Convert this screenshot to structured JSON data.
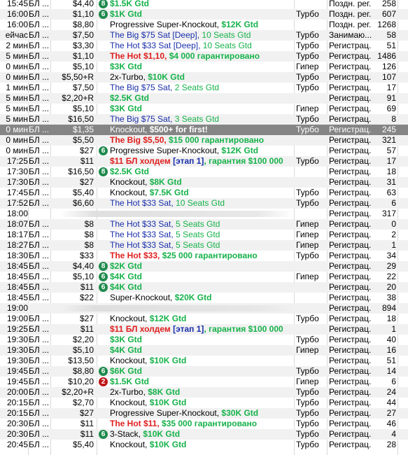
{
  "lobby": {
    "rows": [
      {
        "time": "15:45",
        "game": "БЛ ...",
        "buyin": "$4,40",
        "badge": "8",
        "badge_color": "green",
        "name": [
          {
            "t": "$1.5K Gtd",
            "s": "grn"
          }
        ],
        "speed": "",
        "status": "Поздн. рег.",
        "players": "258"
      },
      {
        "time": "16:00",
        "game": "БЛ ...",
        "buyin": "$1,10",
        "badge": "6",
        "badge_color": "green",
        "name": [
          {
            "t": "$1K Gtd",
            "s": "grn"
          }
        ],
        "speed": "Турбо",
        "status": "Поздн. рег.",
        "players": "607"
      },
      {
        "time": "16:00",
        "game": "БЛ ...",
        "buyin": "$8,80",
        "badge": "",
        "name": [
          {
            "t": "Progressive Super-Knockout, ",
            "s": ""
          },
          {
            "t": "$12K Gtd",
            "s": "grn"
          }
        ],
        "speed": "",
        "status": "Поздн. рег.",
        "players": "1268"
      },
      {
        "time": "ейчас",
        "game": "БЛ ...",
        "buyin": "$7,50",
        "badge": "",
        "name": [
          {
            "t": "The Big $75 Sat [Deep], ",
            "s": "nav"
          },
          {
            "t": "10 Seats Gtd",
            "s": "grn-n"
          }
        ],
        "speed": "Турбо",
        "status": "Занимаю...",
        "players": "58"
      },
      {
        "time": "2 мин",
        "game": "БЛ ...",
        "buyin": "$3,30",
        "badge": "",
        "name": [
          {
            "t": "The Hot $33 Sat [Deep], ",
            "s": "nav"
          },
          {
            "t": "10 Seats Gtd",
            "s": "grn-n"
          }
        ],
        "speed": "Турбо",
        "status": "Регистрац.",
        "players": "51"
      },
      {
        "time": "5 мин",
        "game": "БЛ ...",
        "buyin": "$1,10",
        "badge": "",
        "name": [
          {
            "t": "The Hot ",
            "s": "red"
          },
          {
            "t": "$1,10",
            "s": "red"
          },
          {
            "t": ", ",
            "s": "red"
          },
          {
            "t": "$4 000 гарантировано",
            "s": "grn"
          }
        ],
        "speed": "Турбо",
        "status": "Регистрац.",
        "players": "1486"
      },
      {
        "time": "0 мин",
        "game": "БЛ ...",
        "buyin": "$5,10",
        "badge": "",
        "name": [
          {
            "t": "$3K Gtd",
            "s": "grn"
          }
        ],
        "speed": "Гипер",
        "status": "Регистрац.",
        "players": "126"
      },
      {
        "time": "0 мин",
        "game": "БЛ ...",
        "buyin": "$5,50+R",
        "badge": "",
        "name": [
          {
            "t": "2x-Turbo, ",
            "s": ""
          },
          {
            "t": "$10K Gtd",
            "s": "grn"
          }
        ],
        "speed": "Турбо",
        "status": "Регистрац.",
        "players": "107"
      },
      {
        "time": "1 мин",
        "game": "БЛ ...",
        "buyin": "$7,50",
        "badge": "",
        "name": [
          {
            "t": "The Big $75 Sat, ",
            "s": "nav"
          },
          {
            "t": "2 Seats Gtd",
            "s": "grn-n"
          }
        ],
        "speed": "Турбо",
        "status": "Регистрац.",
        "players": "17"
      },
      {
        "time": "5 мин",
        "game": "БЛ ...",
        "buyin": "$2,20+R",
        "badge": "",
        "name": [
          {
            "t": "$2.5K Gtd",
            "s": "grn"
          }
        ],
        "speed": "",
        "status": "Регистрац.",
        "players": "91"
      },
      {
        "time": "5 мин",
        "game": "БЛ ...",
        "buyin": "$5,10",
        "badge": "",
        "name": [
          {
            "t": "$3K Gtd",
            "s": "grn"
          }
        ],
        "speed": "Гипер",
        "status": "Регистрац.",
        "players": "69"
      },
      {
        "time": "5 мин",
        "game": "БЛ ...",
        "buyin": "$16,50",
        "badge": "",
        "name": [
          {
            "t": "The Big $75 Sat, ",
            "s": "nav"
          },
          {
            "t": "3 Seats Gtd",
            "s": "grn-n"
          }
        ],
        "speed": "Турбо",
        "status": "Регистрац.",
        "players": "8"
      },
      {
        "time": "0 мин",
        "game": "БЛ ...",
        "buyin": "$1,35",
        "badge": "",
        "name": [
          {
            "t": "Knockout, ",
            "s": ""
          },
          {
            "t": "$500+ for first!",
            "s": "grn"
          }
        ],
        "speed": "Турбо",
        "status": "Регистрац.",
        "players": "245",
        "selected": true
      },
      {
        "time": "0 мин",
        "game": "БЛ ...",
        "buyin": "$5,50",
        "badge": "",
        "name": [
          {
            "t": "The Big ",
            "s": "red"
          },
          {
            "t": "$5,50",
            "s": "red"
          },
          {
            "t": ", ",
            "s": "red"
          },
          {
            "t": "$15 000 гарантировано",
            "s": "grn"
          }
        ],
        "speed": "",
        "status": "Регистрац.",
        "players": "321"
      },
      {
        "time": "0 мин",
        "game": "БЛ ...",
        "buyin": "$27",
        "badge": "6",
        "badge_color": "green",
        "name": [
          {
            "t": "Progressive Super-Knockout, ",
            "s": ""
          },
          {
            "t": "$12K Gtd",
            "s": "grn"
          }
        ],
        "speed": "",
        "status": "Регистрац.",
        "players": "57"
      },
      {
        "time": "17:25",
        "game": "БЛ ...",
        "buyin": "$11",
        "badge": "",
        "name": [
          {
            "t": "$11 БЛ холдем ",
            "s": "red"
          },
          {
            "t": "[этап 1]",
            "s": "blu"
          },
          {
            "t": ", гарантия $100 000",
            "s": "grn"
          }
        ],
        "speed": "Турбо",
        "status": "Регистрац.",
        "players": "17"
      },
      {
        "time": "17:30",
        "game": "БЛ ...",
        "buyin": "$16,50",
        "badge": "8",
        "badge_color": "green",
        "name": [
          {
            "t": "$2.5K Gtd",
            "s": "grn"
          }
        ],
        "speed": "",
        "status": "Регистрац.",
        "players": "18"
      },
      {
        "time": "17:30",
        "game": "БЛ ...",
        "buyin": "$27",
        "badge": "",
        "name": [
          {
            "t": "Knockout, ",
            "s": ""
          },
          {
            "t": "$8K Gtd",
            "s": "grn"
          }
        ],
        "speed": "",
        "status": "Регистрац.",
        "players": "31"
      },
      {
        "time": "17:45",
        "game": "БЛ ...",
        "buyin": "$5,40",
        "badge": "",
        "name": [
          {
            "t": "Knockout, ",
            "s": ""
          },
          {
            "t": "$7.5K Gtd",
            "s": "grn"
          }
        ],
        "speed": "Турбо",
        "status": "Регистрац.",
        "players": "63"
      },
      {
        "time": "17:52",
        "game": "БЛ ...",
        "buyin": "$6,60",
        "badge": "",
        "name": [
          {
            "t": "The Hot $33 Sat, ",
            "s": "nav"
          },
          {
            "t": "10 Seats Gtd",
            "s": "grn-n"
          }
        ],
        "speed": "Турбо",
        "status": "Регистрац.",
        "players": "6"
      },
      {
        "time": "18:00",
        "game": "",
        "buyin": "",
        "badge": "",
        "name": [],
        "speed": "",
        "status": "Регистрац.",
        "players": "317",
        "blurred": true
      },
      {
        "time": "18:07",
        "game": "БЛ ...",
        "buyin": "$8",
        "badge": "",
        "name": [
          {
            "t": "The Hot $33 Sat, ",
            "s": "nav"
          },
          {
            "t": "5 Seats Gtd",
            "s": "grn-n"
          }
        ],
        "speed": "Гипер",
        "status": "Регистрац.",
        "players": "0"
      },
      {
        "time": "18:17",
        "game": "БЛ ...",
        "buyin": "$8",
        "badge": "",
        "name": [
          {
            "t": "The Hot $33 Sat, ",
            "s": "nav"
          },
          {
            "t": "5 Seats Gtd",
            "s": "grn-n"
          }
        ],
        "speed": "Гипер",
        "status": "Регистрац.",
        "players": "2"
      },
      {
        "time": "18:27",
        "game": "БЛ ...",
        "buyin": "$8",
        "badge": "",
        "name": [
          {
            "t": "The Hot $33 Sat, ",
            "s": "nav"
          },
          {
            "t": "5 Seats Gtd",
            "s": "grn-n"
          }
        ],
        "speed": "Гипер",
        "status": "Регистрац.",
        "players": "1"
      },
      {
        "time": "18:30",
        "game": "БЛ ...",
        "buyin": "$33",
        "badge": "",
        "name": [
          {
            "t": "The Hot ",
            "s": "red"
          },
          {
            "t": "$33",
            "s": "red"
          },
          {
            "t": ", ",
            "s": "red"
          },
          {
            "t": "$25 000 гарантировано",
            "s": "grn"
          }
        ],
        "speed": "Турбо",
        "status": "Регистрац.",
        "players": "34"
      },
      {
        "time": "18:45",
        "game": "БЛ ...",
        "buyin": "$4,40",
        "badge": "8",
        "badge_color": "green",
        "name": [
          {
            "t": "$2K Gtd",
            "s": "grn"
          }
        ],
        "speed": "",
        "status": "Регистрац.",
        "players": "29"
      },
      {
        "time": "18:45",
        "game": "БЛ ...",
        "buyin": "$5,10",
        "badge": "6",
        "badge_color": "green",
        "name": [
          {
            "t": "$4K Gtd",
            "s": "grn"
          }
        ],
        "speed": "Гипер",
        "status": "Регистрац.",
        "players": "22"
      },
      {
        "time": "18:45",
        "game": "БЛ ...",
        "buyin": "$11",
        "badge": "6",
        "badge_color": "green",
        "name": [
          {
            "t": "$4K Gtd",
            "s": "grn"
          }
        ],
        "speed": "",
        "status": "Регистрац.",
        "players": "20"
      },
      {
        "time": "18:45",
        "game": "БЛ ...",
        "buyin": "$22",
        "badge": "",
        "name": [
          {
            "t": "Super-Knockout, ",
            "s": ""
          },
          {
            "t": "$20K Gtd",
            "s": "grn"
          }
        ],
        "speed": "",
        "status": "Регистрац.",
        "players": "38"
      },
      {
        "time": "19:00",
        "game": "",
        "buyin": "",
        "badge": "",
        "name": [],
        "speed": "",
        "status": "Регистрац.",
        "players": "894",
        "blurred": true
      },
      {
        "time": "19:00",
        "game": "БЛ ...",
        "buyin": "$27",
        "badge": "",
        "name": [
          {
            "t": "Knockout, ",
            "s": ""
          },
          {
            "t": "$12K Gtd",
            "s": "grn"
          }
        ],
        "speed": "Турбо",
        "status": "Регистрац.",
        "players": "18"
      },
      {
        "time": "19:25",
        "game": "БЛ ...",
        "buyin": "$11",
        "badge": "",
        "name": [
          {
            "t": "$11 БЛ холдем ",
            "s": "red"
          },
          {
            "t": "[этап 1]",
            "s": "blu"
          },
          {
            "t": ", гарантия $100 000",
            "s": "grn"
          }
        ],
        "speed": "",
        "status": "Регистрац.",
        "players": "1"
      },
      {
        "time": "19:30",
        "game": "БЛ ...",
        "buyin": "$2,20",
        "badge": "",
        "name": [
          {
            "t": "$3K Gtd",
            "s": "grn"
          }
        ],
        "speed": "Турбо",
        "status": "Регистрац.",
        "players": "40"
      },
      {
        "time": "19:30",
        "game": "БЛ ...",
        "buyin": "$5,10",
        "badge": "",
        "name": [
          {
            "t": "$4K Gtd",
            "s": "grn"
          }
        ],
        "speed": "Гипер",
        "status": "Регистрац.",
        "players": "16"
      },
      {
        "time": "19:30",
        "game": "БЛ ...",
        "buyin": "$13,50",
        "badge": "",
        "name": [
          {
            "t": "Knockout, ",
            "s": ""
          },
          {
            "t": "$10K Gtd",
            "s": "grn"
          }
        ],
        "speed": "",
        "status": "Регистрац.",
        "players": "51"
      },
      {
        "time": "19:45",
        "game": "БЛ ...",
        "buyin": "$8,80",
        "badge": "6",
        "badge_color": "green",
        "name": [
          {
            "t": "$6K Gtd",
            "s": "grn"
          }
        ],
        "speed": "Турбо",
        "status": "Регистрац.",
        "players": "14"
      },
      {
        "time": "19:45",
        "game": "БЛ ...",
        "buyin": "$10,20",
        "badge": "2",
        "badge_color": "red",
        "name": [
          {
            "t": "$1.5K Gtd",
            "s": "grn"
          }
        ],
        "speed": "Гипер",
        "status": "Регистрац.",
        "players": "6"
      },
      {
        "time": "20:00",
        "game": "БЛ ...",
        "buyin": "$2,20+R",
        "badge": "",
        "name": [
          {
            "t": "2x-Turbo, ",
            "s": ""
          },
          {
            "t": "$8K Gtd",
            "s": "grn"
          }
        ],
        "speed": "Турбо",
        "status": "Регистрац.",
        "players": "24"
      },
      {
        "time": "20:15",
        "game": "БЛ ...",
        "buyin": "$2,70",
        "badge": "",
        "name": [
          {
            "t": "Knockout, ",
            "s": ""
          },
          {
            "t": "$10K Gtd",
            "s": "grn"
          }
        ],
        "speed": "Турбо",
        "status": "Регистрац.",
        "players": "44"
      },
      {
        "time": "20:15",
        "game": "БЛ ...",
        "buyin": "$27",
        "badge": "",
        "name": [
          {
            "t": "Progressive Super-Knockout, ",
            "s": ""
          },
          {
            "t": "$30K Gtd",
            "s": "grn"
          }
        ],
        "speed": "Турбо",
        "status": "Регистрац.",
        "players": "27"
      },
      {
        "time": "20:30",
        "game": "БЛ ...",
        "buyin": "$11",
        "badge": "",
        "name": [
          {
            "t": "The Hot ",
            "s": "red"
          },
          {
            "t": "$11",
            "s": "red"
          },
          {
            "t": ", ",
            "s": "red"
          },
          {
            "t": "$35 000 гарантировано",
            "s": "grn"
          }
        ],
        "speed": "Турбо",
        "status": "Регистрац.",
        "players": "46"
      },
      {
        "time": "20:30",
        "game": "БЛ ...",
        "buyin": "$11",
        "badge": "6",
        "badge_color": "green",
        "name": [
          {
            "t": "3-Stack, ",
            "s": ""
          },
          {
            "t": "$10K Gtd",
            "s": "grn"
          }
        ],
        "speed": "Турбо",
        "status": "Регистрац.",
        "players": "4"
      },
      {
        "time": "20:45",
        "game": "БЛ ...",
        "buyin": "$5,40",
        "badge": "",
        "name": [
          {
            "t": "Knockout, ",
            "s": ""
          },
          {
            "t": "$10K Gtd",
            "s": "grn"
          }
        ],
        "speed": "Турбо",
        "status": "Регистрац.",
        "players": "28"
      }
    ]
  }
}
